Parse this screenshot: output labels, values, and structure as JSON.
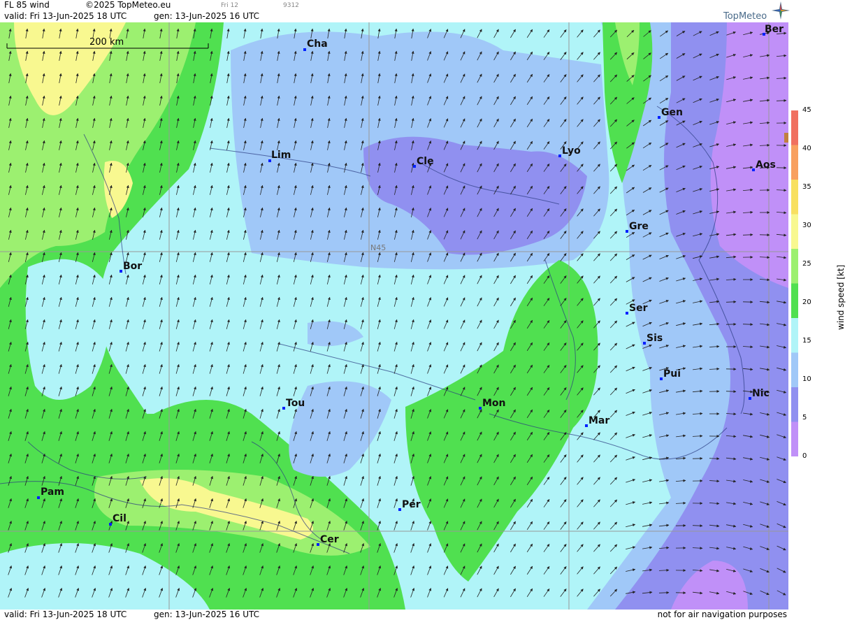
{
  "header": {
    "product": "FL 85 wind",
    "copyright": "©2025 TopMeteo.eu",
    "valid": "valid:  Fri  13-Jun-2025  18 UTC",
    "gen": "gen: 13-Jun-2025 16 UTC",
    "small_tag_1": "Fri 12",
    "small_tag_2": "9312"
  },
  "logo": {
    "text": "TopMeteo",
    "icon": "compass-star-icon"
  },
  "scale_bar": {
    "label": "200 km"
  },
  "gridline_label": "N45",
  "footer": {
    "valid": "valid:  Fri  13-Jun-2025  18 UTC",
    "gen": "gen: 13-Jun-2025 16 UTC",
    "disclaimer": "not for air navigation purposes"
  },
  "legend": {
    "title": "wind  speed  [kt]",
    "ticks": [
      "45",
      "40",
      "35",
      "30",
      "25",
      "20",
      "15",
      "10",
      "5",
      "0"
    ],
    "colors": [
      "#f07060",
      "#f8a060",
      "#f8e060",
      "#f8f890",
      "#9cf070",
      "#50e050",
      "#b0f4f8",
      "#a0c8f8",
      "#9090f0",
      "#c090f8"
    ]
  },
  "cities": [
    {
      "name": "Cha"
    },
    {
      "name": "Ber"
    },
    {
      "name": "Gen"
    },
    {
      "name": "Lim"
    },
    {
      "name": "Cle"
    },
    {
      "name": "Lyo"
    },
    {
      "name": "Aos"
    },
    {
      "name": "Gre"
    },
    {
      "name": "Bor"
    },
    {
      "name": "Ser"
    },
    {
      "name": "Sis"
    },
    {
      "name": "Pui"
    },
    {
      "name": "Nic"
    },
    {
      "name": "Tou"
    },
    {
      "name": "Mon"
    },
    {
      "name": "Mar"
    },
    {
      "name": "Pam"
    },
    {
      "name": "Cil"
    },
    {
      "name": "Per"
    },
    {
      "name": "Cer"
    }
  ],
  "colors": {
    "city_marker": "#0020ff"
  }
}
